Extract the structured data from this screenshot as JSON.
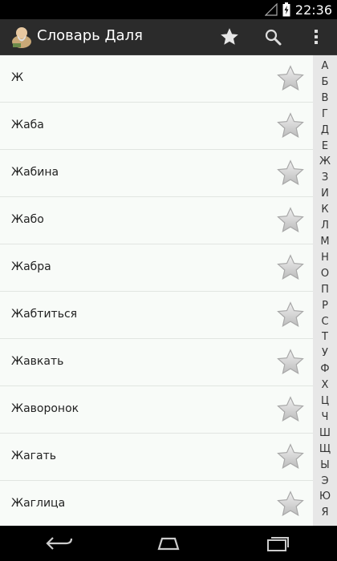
{
  "status": {
    "time": "22:36"
  },
  "app": {
    "title": "Словарь Даля"
  },
  "words": [
    "Ж",
    "Жаба",
    "Жабина",
    "Жабо",
    "Жабра",
    "Жабтиться",
    "Жавкать",
    "Жаворонок",
    "Жагать",
    "Жаглица"
  ],
  "index": [
    "А",
    "Б",
    "В",
    "Г",
    "Д",
    "Е",
    "Ж",
    "З",
    "И",
    "К",
    "Л",
    "М",
    "Н",
    "О",
    "П",
    "Р",
    "С",
    "Т",
    "У",
    "Ф",
    "Х",
    "Ц",
    "Ч",
    "Ш",
    "Щ",
    "Ы",
    "Э",
    "Ю",
    "Я"
  ],
  "icons": {
    "favorites": "star-icon",
    "search": "search-icon",
    "menu": "overflow-menu-icon",
    "back": "back-icon",
    "home": "home-icon",
    "recents": "recents-icon"
  }
}
